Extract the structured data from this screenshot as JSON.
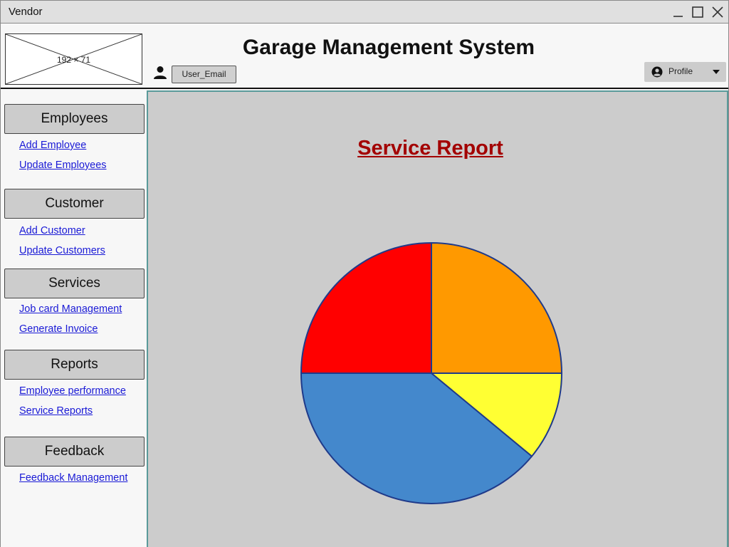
{
  "window": {
    "title": "Vendor",
    "controls": [
      "minimize-icon",
      "maximize-icon",
      "close-icon"
    ]
  },
  "header": {
    "logo_placeholder": "192 × 71",
    "app_title": "Garage Management System",
    "user_email": "User_Email",
    "profile_label": "Profile"
  },
  "sidebar": {
    "sections": [
      {
        "label": "Employees",
        "links": [
          "Add Employee",
          "Update Employees"
        ]
      },
      {
        "label": "Customer",
        "links": [
          "Add Customer",
          "Update Customers"
        ]
      },
      {
        "label": "Services",
        "links": [
          "Job card Management",
          "Generate Invoice"
        ]
      },
      {
        "label": "Reports",
        "links": [
          "Employee performance",
          "Service Reports"
        ]
      },
      {
        "label": "Feedback",
        "links": [
          "Feedback Management"
        ]
      }
    ]
  },
  "main": {
    "report_title": "Service Report"
  },
  "chart_data": {
    "type": "pie",
    "values": [
      25,
      11,
      39,
      25
    ],
    "colors": [
      "#ff9900",
      "#ffff33",
      "#4488cc",
      "#ff0000"
    ]
  }
}
